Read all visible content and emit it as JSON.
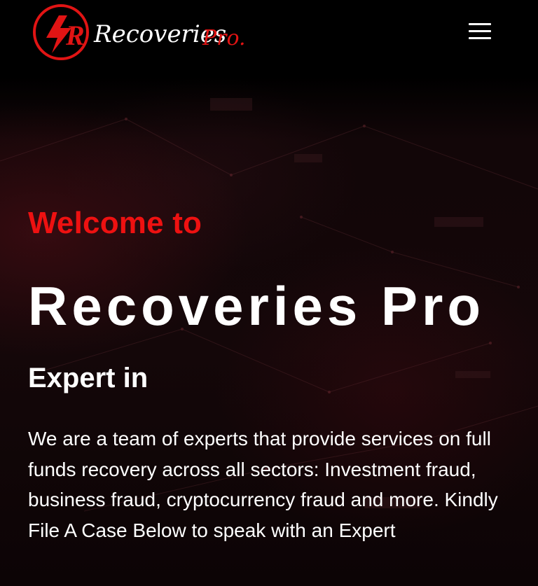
{
  "header": {
    "logo": {
      "icon_letter": "R",
      "wordmark_main": "Recoveries",
      "wordmark_accent": "Pro."
    },
    "menu_icon": "hamburger-menu-icon"
  },
  "hero": {
    "welcome": "Welcome to",
    "title": "Recoveries Pro",
    "subtitle": "Expert in",
    "description": "We are a team of experts that provide services on full funds recovery across all sectors: Investment fraud, business fraud, cryptocurrency fraud and more. Kindly File A Case Below to speak with an Expert"
  },
  "colors": {
    "accent": "#ee1111",
    "background": "#000000",
    "text": "#ffffff"
  }
}
